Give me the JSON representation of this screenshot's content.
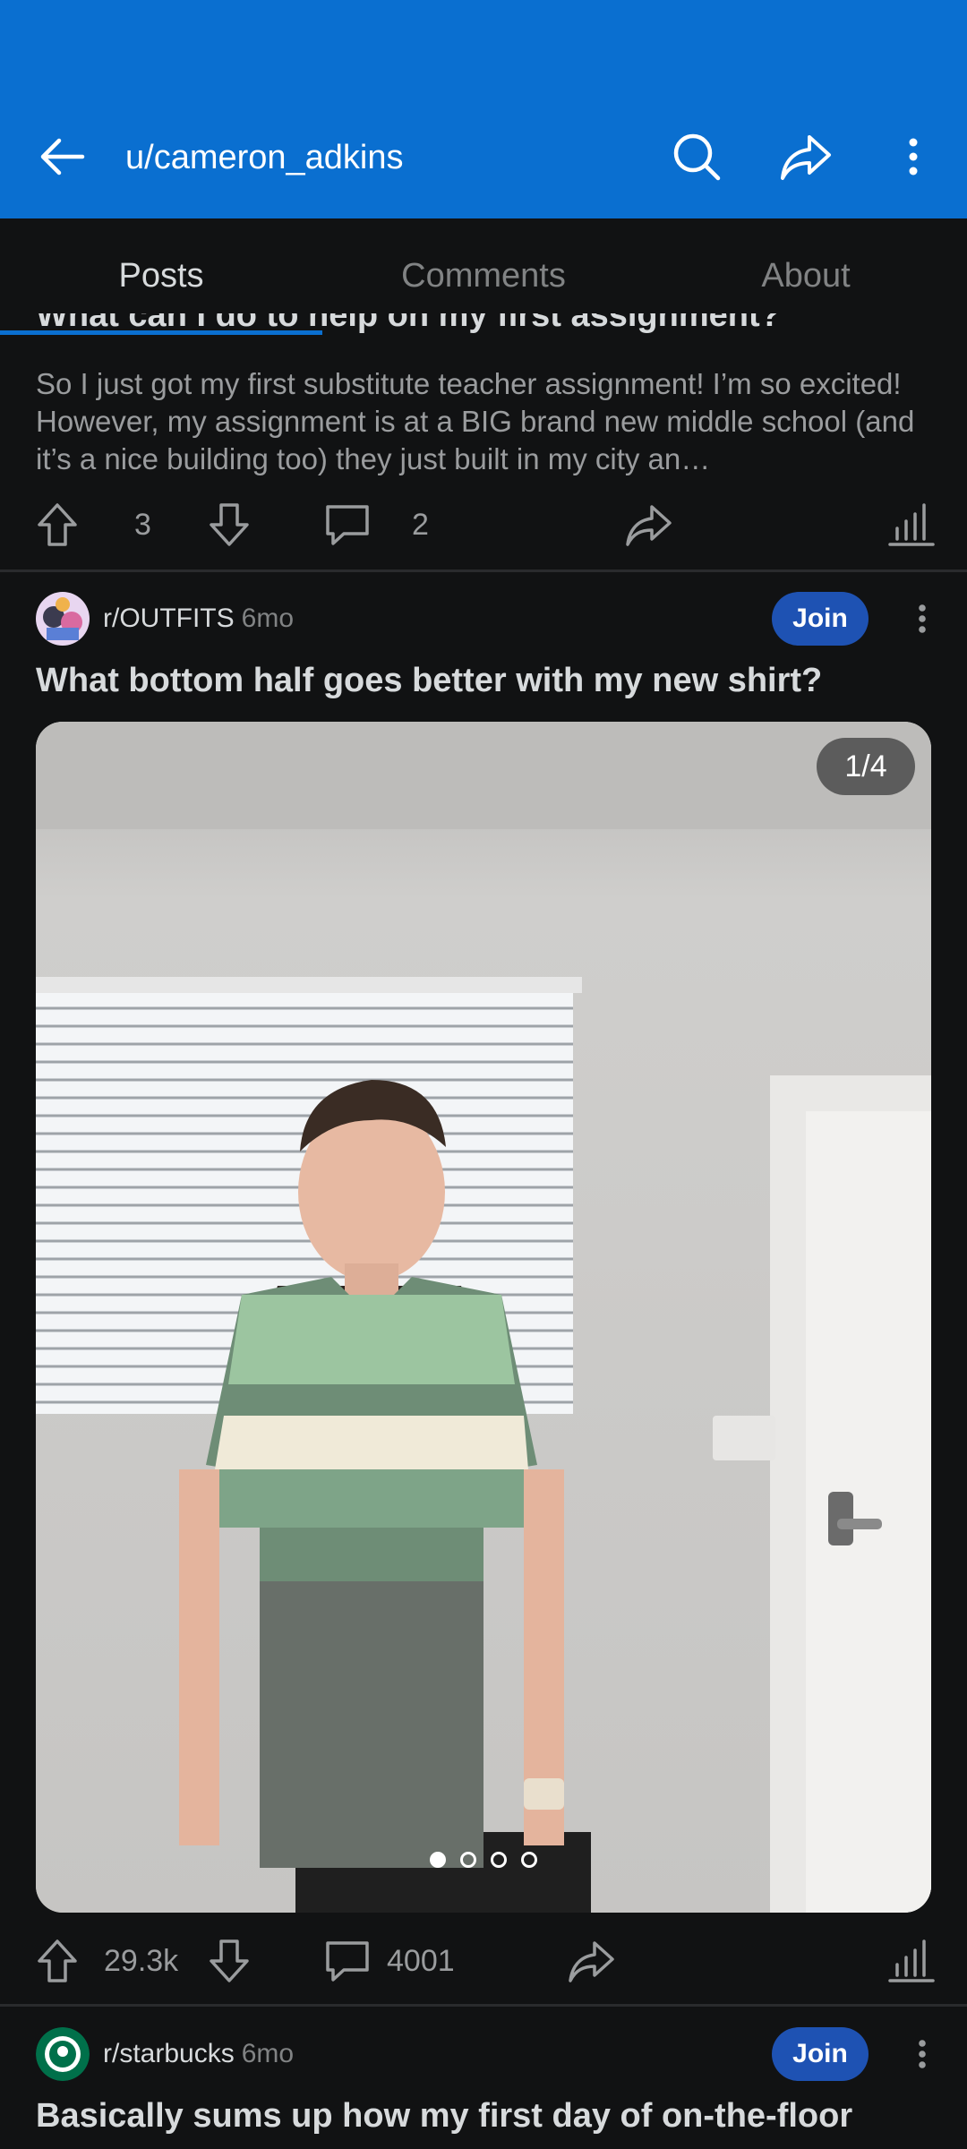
{
  "appbar": {
    "title": "u/cameron_adkins",
    "back_icon": "arrow-left-icon",
    "search_icon": "search-icon",
    "share_icon": "share-icon",
    "more_icon": "more-vertical-icon"
  },
  "tabs": [
    {
      "label": "Posts",
      "active": true
    },
    {
      "label": "Comments",
      "active": false
    },
    {
      "label": "About",
      "active": false
    }
  ],
  "posts": [
    {
      "title": "What can I do to help on my first assignment?",
      "snippet": "So I just got my first substitute teacher assignment! I’m so excited! However, my assignment is at a BIG brand new middle school (and it’s a nice building too) they just built in my city an…",
      "votes": "3",
      "comments": "2"
    },
    {
      "subreddit": "r/OUTFITS",
      "age": "6mo",
      "join_label": "Join",
      "title": "What bottom half goes better with my new shirt?",
      "image_counter": "1/4",
      "image_count": 4,
      "image_index": 1,
      "votes": "29.3k",
      "comments": "4001"
    },
    {
      "subreddit": "r/starbucks",
      "age": "6mo",
      "join_label": "Join",
      "title": "Basically sums up how my first day of on-the-floor"
    }
  ],
  "colors": {
    "appbar": "#0a6fd0",
    "background": "#111213",
    "join_button": "#1e52b3"
  }
}
